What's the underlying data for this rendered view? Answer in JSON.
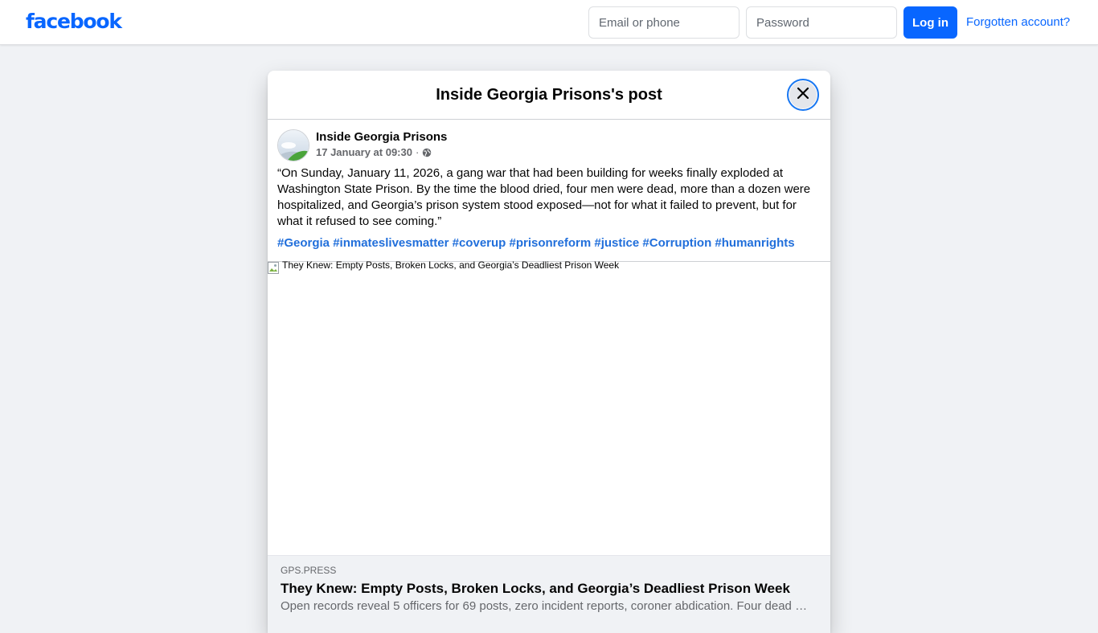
{
  "topbar": {
    "logo": "facebook",
    "email_placeholder": "Email or phone",
    "password_placeholder": "Password",
    "login_label": "Log in",
    "forgot_label": "Forgotten account?"
  },
  "modal": {
    "title": "Inside Georgia Prisons's post",
    "close_icon": "close-icon"
  },
  "post": {
    "author": "Inside Georgia Prisons",
    "timestamp": "17 January at 09:30",
    "separator": "·",
    "audience_icon": "globe-icon",
    "text": "“On Sunday, January 11, 2026, a gang war that had been building for weeks finally exploded at Washington State Prison. By the time the blood dried, four men were dead, more than a dozen were hospitalized, and Georgia’s prison system stood exposed—not for what it failed to prevent, but for what it refused to see coming.”",
    "hashtags": [
      "#Georgia",
      "#inmateslivesmatter",
      "#coverup",
      "#prisonreform",
      "#justice",
      "#Corruption",
      "#humanrights"
    ]
  },
  "link_preview": {
    "image_alt": "They Knew: Empty Posts, Broken Locks, and Georgia’s Deadliest Prison Week",
    "domain": "GPS.PRESS",
    "title": "They Knew: Empty Posts, Broken Locks, and Georgia’s Deadliest Prison Week",
    "description": "Open records reveal 5 officers for 69 posts, zero incident reports, coroner abdication. Four dead a..."
  },
  "colors": {
    "brand": "#0866ff",
    "hashtag": "#216fdb",
    "background": "#f0f2f5"
  }
}
